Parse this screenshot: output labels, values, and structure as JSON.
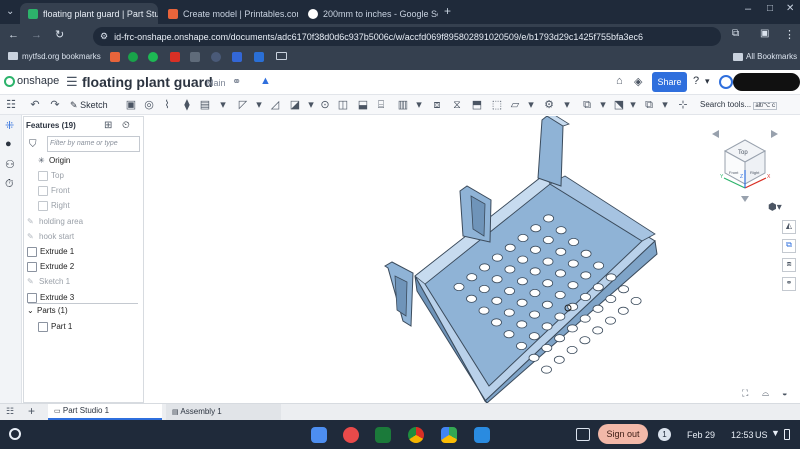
{
  "browser": {
    "tabs": [
      {
        "title": "floating plant guard | Part Studio",
        "active": true
      },
      {
        "title": "Create model | Printables.com",
        "active": false
      },
      {
        "title": "200mm to inches - Google Search",
        "active": false
      }
    ],
    "url": "id-frc-onshape.onshape.com/documents/adc6170f38d0d6c937b5006c/w/accfd069f895802891020509/e/b1793d29c1425f755bfa3ec6",
    "bookmarks": {
      "first": "mytfsd.org bookmarks",
      "all": "All Bookmarks"
    }
  },
  "onshape": {
    "brand": "onshape",
    "doc_title": "floating plant guard",
    "branch": "Main",
    "share_label": "Share",
    "sketch_label": "Sketch",
    "search_tools": "Search tools...",
    "search_shortcut": "alt/⌥ c"
  },
  "features": {
    "header": "Features (19)",
    "filter_placeholder": "Filter by name or type",
    "items": [
      {
        "label": "Origin",
        "dim": false
      },
      {
        "label": "Top",
        "dim": true
      },
      {
        "label": "Front",
        "dim": true
      },
      {
        "label": "Right",
        "dim": true
      },
      {
        "label": "holding area",
        "dim": true
      },
      {
        "label": "hook start",
        "dim": true
      },
      {
        "label": "Extrude 1",
        "dim": false
      },
      {
        "label": "Extrude 2",
        "dim": false
      },
      {
        "label": "Sketch 1",
        "dim": true
      },
      {
        "label": "Extrude 3",
        "dim": false
      }
    ],
    "parts_header": "Parts (1)",
    "parts": [
      "Part 1"
    ]
  },
  "viewcube": {
    "top": "Top",
    "front": "Front",
    "right": "Right",
    "x": "X",
    "y": "Y",
    "z": "Z"
  },
  "bottom_tabs": [
    "Part Studio 1",
    "Assembly 1"
  ],
  "shelf": {
    "signout": "Sign out",
    "date": "Feb 29",
    "time": "12:53",
    "locale": "US",
    "notif": "1"
  }
}
